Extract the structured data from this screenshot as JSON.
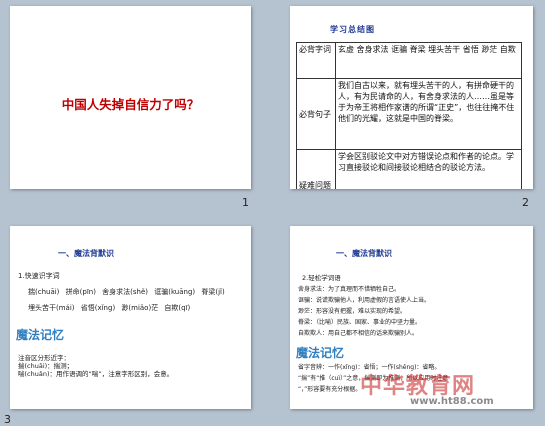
{
  "slides": [
    {
      "number": "1",
      "title": "中国人失掉自信力了吗？"
    },
    {
      "number": "2",
      "heading": "学习总结图",
      "rows": [
        {
          "key": "必背字词",
          "value": "玄虚  舍身求法  诓骗  脊梁  埋头苦干  省悟  渺茫  自欺"
        },
        {
          "key": "必背句子",
          "value": "我们自古以来，就有埋头苦干的人，有拼命硬干的人，有为民请命的人，有舍身求法的人……虽是等于为帝王将相作家谱的所谓“正史”，也往往掩不住他们的光耀，这就是中国的脊梁。"
        },
        {
          "key": "疑难问题",
          "value": "学会区别驳论文中对方错误论点和作者的论点。学习直接驳论和间接驳论相结合的驳论方法。"
        }
      ]
    },
    {
      "number": "3",
      "heading": "一、魔法背默识",
      "line1": "1.快速识字词",
      "words1": "揣(chuāi)  拼命(pīn)  舍身求法(shě)  诓骗(kuāng)  脊梁(jǐ)",
      "words2": "埋头苦干(mái)  省悟(xǐng)  渺(miǎo)茫  自欺(qī)",
      "magic": "魔法记忆",
      "mem1": "注音区分形近字：",
      "mem2": "揣(chuāi)：揣测；",
      "mem3": "喘(chuǎn)：用作语调的“喘”，注意字形区别，会意。"
    },
    {
      "number": "4",
      "heading": "一、魔法背默识",
      "sub": "2.轻松学词语",
      "lines": [
        "舍身求法：为了真理而不惜牺牲自己。",
        "诓骗：说谎欺骗他人，利用虚假的言语使人上当。",
        "渺茫：形容没有把握，难以实现的希望。",
        "脊梁：（比喻）民族、国家、事业的中坚力量。",
        "自欺欺人：用自己都不相信的话来欺骗别人。"
      ],
      "magic": "魔法记忆",
      "mem_lines": [
        "省字音辨：一作(xǐng)：省悟；一作(shěng)：省略。",
        "“揣”有“推（cuì）”之意，揣测即为推测，所以应用时注意",
        "“，”形容要有充分根据。"
      ]
    }
  ],
  "watermark": {
    "text": "中华教育网",
    "url": "www.ht88.com"
  }
}
